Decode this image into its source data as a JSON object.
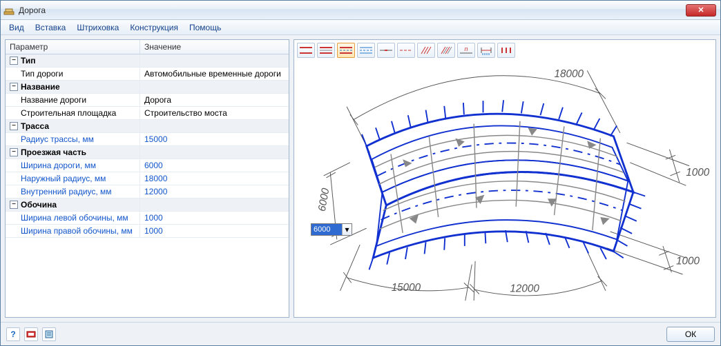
{
  "window": {
    "title": "Дорога"
  },
  "menu": {
    "items": [
      "Вид",
      "Вставка",
      "Штриховка",
      "Конструкция",
      "Помощь"
    ]
  },
  "grid": {
    "headers": {
      "param": "Параметр",
      "value": "Значение"
    },
    "groups": [
      {
        "label": "Тип",
        "rows": [
          {
            "param": "Тип дороги",
            "value": "Автомобильные временные дороги",
            "link": false
          }
        ]
      },
      {
        "label": "Название",
        "rows": [
          {
            "param": "Название дороги",
            "value": "Дорога",
            "link": false
          },
          {
            "param": "Строительная площадка",
            "value": "Строительство моста",
            "link": false
          }
        ]
      },
      {
        "label": "Трасса",
        "rows": [
          {
            "param": "Радиус трассы, мм",
            "value": "15000",
            "link": true
          }
        ]
      },
      {
        "label": "Проезжая часть",
        "rows": [
          {
            "param": "Ширина дороги, мм",
            "value": "6000",
            "link": true
          },
          {
            "param": "Наружный радиус, мм",
            "value": "18000",
            "link": true
          },
          {
            "param": "Внутренний радиус, мм",
            "value": "12000",
            "link": true
          }
        ]
      },
      {
        "label": "Обочина",
        "rows": [
          {
            "param": "Ширина левой обочины, мм",
            "value": "1000",
            "link": true
          },
          {
            "param": "Ширина правой обочины, мм",
            "value": "1000",
            "link": true
          }
        ]
      }
    ]
  },
  "preview": {
    "input_value": "6000",
    "dims": {
      "top": "18000",
      "right_upper": "1000",
      "right_lower": "1000",
      "bottom_left": "15000",
      "bottom_right": "12000",
      "left": "6000"
    }
  },
  "footer": {
    "ok": "ОК"
  }
}
